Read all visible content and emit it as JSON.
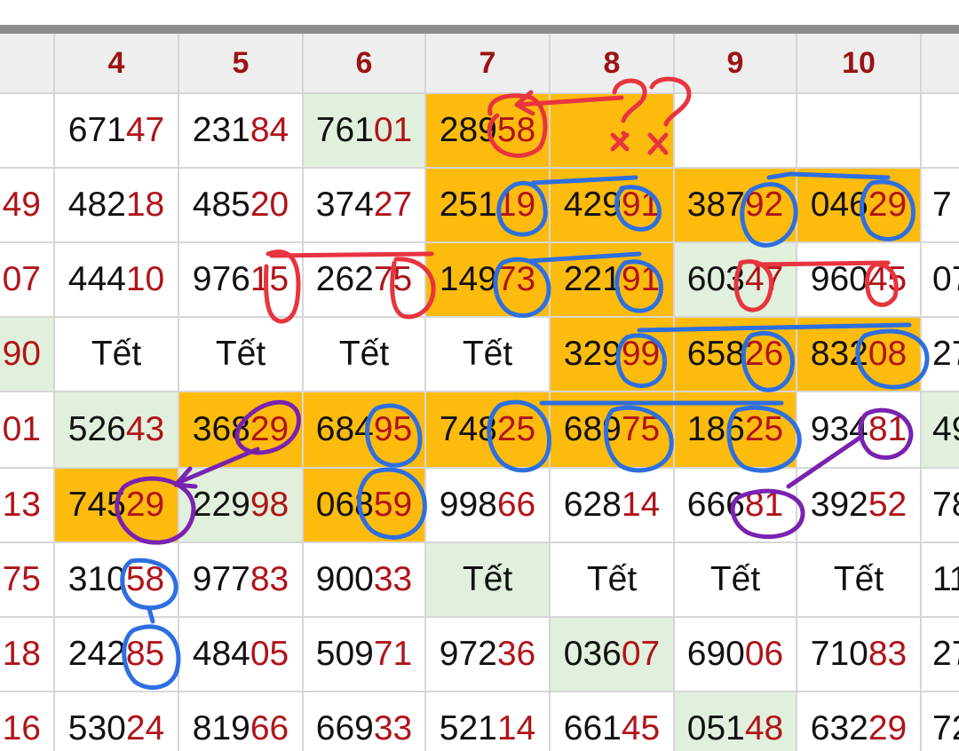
{
  "colors": {
    "header_text": "#9a1414",
    "highlight_digits": "#b0141a",
    "orange_cell": "#fdbb0d",
    "green_cell": "#e1f0dc",
    "pen_red": "#e8343f",
    "pen_blue": "#2d6fe0",
    "pen_purple": "#7a22b0"
  },
  "header": {
    "columns": [
      "",
      "4",
      "5",
      "6",
      "7",
      "8",
      "9",
      "10",
      ""
    ]
  },
  "rows": [
    {
      "cells": [
        {
          "p": "",
          "s": "",
          "bg": ""
        },
        {
          "p": "671",
          "s": "47",
          "bg": ""
        },
        {
          "p": "231",
          "s": "84",
          "bg": ""
        },
        {
          "p": "761",
          "s": "01",
          "bg": "green"
        },
        {
          "p": "289",
          "s": "58",
          "bg": "orange"
        },
        {
          "p": "",
          "s": "",
          "bg": "orange"
        },
        {
          "p": "",
          "s": "",
          "bg": ""
        },
        {
          "p": "",
          "s": "",
          "bg": ""
        },
        {
          "p": "",
          "s": "",
          "bg": ""
        }
      ]
    },
    {
      "cells": [
        {
          "p": "",
          "s": "49",
          "bg": ""
        },
        {
          "p": "482",
          "s": "18",
          "bg": ""
        },
        {
          "p": "485",
          "s": "20",
          "bg": ""
        },
        {
          "p": "374",
          "s": "27",
          "bg": ""
        },
        {
          "p": "251",
          "s": "19",
          "bg": "orange"
        },
        {
          "p": "429",
          "s": "91",
          "bg": "orange"
        },
        {
          "p": "387",
          "s": "92",
          "bg": "orange"
        },
        {
          "p": "046",
          "s": "29",
          "bg": "orange"
        },
        {
          "p": "7",
          "s": "",
          "bg": ""
        }
      ]
    },
    {
      "cells": [
        {
          "p": "",
          "s": "07",
          "bg": ""
        },
        {
          "p": "444",
          "s": "10",
          "bg": ""
        },
        {
          "p": "976",
          "s": "15",
          "bg": ""
        },
        {
          "p": "262",
          "s": "75",
          "bg": ""
        },
        {
          "p": "149",
          "s": "73",
          "bg": "orange"
        },
        {
          "p": "221",
          "s": "91",
          "bg": "orange"
        },
        {
          "p": "603",
          "s": "47",
          "bg": "green"
        },
        {
          "p": "960",
          "s": "45",
          "bg": ""
        },
        {
          "p": "07",
          "s": "",
          "bg": ""
        }
      ]
    },
    {
      "cells": [
        {
          "p": "",
          "s": "90",
          "bg": "green"
        },
        {
          "p": "Tết",
          "s": "",
          "bg": ""
        },
        {
          "p": "Tết",
          "s": "",
          "bg": ""
        },
        {
          "p": "Tết",
          "s": "",
          "bg": ""
        },
        {
          "p": "Tết",
          "s": "",
          "bg": ""
        },
        {
          "p": "329",
          "s": "99",
          "bg": "orange"
        },
        {
          "p": "658",
          "s": "26",
          "bg": "orange"
        },
        {
          "p": "832",
          "s": "08",
          "bg": "orange"
        },
        {
          "p": "27",
          "s": "",
          "bg": ""
        }
      ]
    },
    {
      "cells": [
        {
          "p": "",
          "s": "01",
          "bg": ""
        },
        {
          "p": "526",
          "s": "43",
          "bg": "green"
        },
        {
          "p": "368",
          "s": "29",
          "bg": "orange"
        },
        {
          "p": "684",
          "s": "95",
          "bg": "orange"
        },
        {
          "p": "748",
          "s": "25",
          "bg": "orange"
        },
        {
          "p": "689",
          "s": "75",
          "bg": "orange"
        },
        {
          "p": "186",
          "s": "25",
          "bg": "orange"
        },
        {
          "p": "934",
          "s": "81",
          "bg": ""
        },
        {
          "p": "49",
          "s": "",
          "bg": "green"
        }
      ]
    },
    {
      "cells": [
        {
          "p": "",
          "s": "13",
          "bg": ""
        },
        {
          "p": "745",
          "s": "29",
          "bg": "orange"
        },
        {
          "p": "229",
          "s": "98",
          "bg": "green"
        },
        {
          "p": "068",
          "s": "59",
          "bg": "orange"
        },
        {
          "p": "998",
          "s": "66",
          "bg": ""
        },
        {
          "p": "628",
          "s": "14",
          "bg": ""
        },
        {
          "p": "666",
          "s": "81",
          "bg": ""
        },
        {
          "p": "392",
          "s": "52",
          "bg": ""
        },
        {
          "p": "78",
          "s": "",
          "bg": ""
        }
      ]
    },
    {
      "cells": [
        {
          "p": "",
          "s": "75",
          "bg": ""
        },
        {
          "p": "310",
          "s": "58",
          "bg": ""
        },
        {
          "p": "977",
          "s": "83",
          "bg": ""
        },
        {
          "p": "900",
          "s": "33",
          "bg": ""
        },
        {
          "p": "Tết",
          "s": "",
          "bg": "green"
        },
        {
          "p": "Tết",
          "s": "",
          "bg": ""
        },
        {
          "p": "Tết",
          "s": "",
          "bg": ""
        },
        {
          "p": "Tết",
          "s": "",
          "bg": ""
        },
        {
          "p": "11",
          "s": "",
          "bg": ""
        }
      ]
    },
    {
      "cells": [
        {
          "p": "",
          "s": "18",
          "bg": ""
        },
        {
          "p": "242",
          "s": "85",
          "bg": ""
        },
        {
          "p": "484",
          "s": "05",
          "bg": ""
        },
        {
          "p": "509",
          "s": "71",
          "bg": ""
        },
        {
          "p": "972",
          "s": "36",
          "bg": ""
        },
        {
          "p": "036",
          "s": "07",
          "bg": "green"
        },
        {
          "p": "690",
          "s": "06",
          "bg": ""
        },
        {
          "p": "710",
          "s": "83",
          "bg": ""
        },
        {
          "p": "27",
          "s": "",
          "bg": ""
        }
      ]
    },
    {
      "cells": [
        {
          "p": "",
          "s": "16",
          "bg": ""
        },
        {
          "p": "530",
          "s": "24",
          "bg": ""
        },
        {
          "p": "819",
          "s": "66",
          "bg": ""
        },
        {
          "p": "669",
          "s": "33",
          "bg": ""
        },
        {
          "p": "521",
          "s": "14",
          "bg": ""
        },
        {
          "p": "661",
          "s": "45",
          "bg": ""
        },
        {
          "p": "051",
          "s": "48",
          "bg": "green"
        },
        {
          "p": "632",
          "s": "29",
          "bg": ""
        },
        {
          "p": "72",
          "s": "",
          "bg": ""
        }
      ]
    }
  ]
}
